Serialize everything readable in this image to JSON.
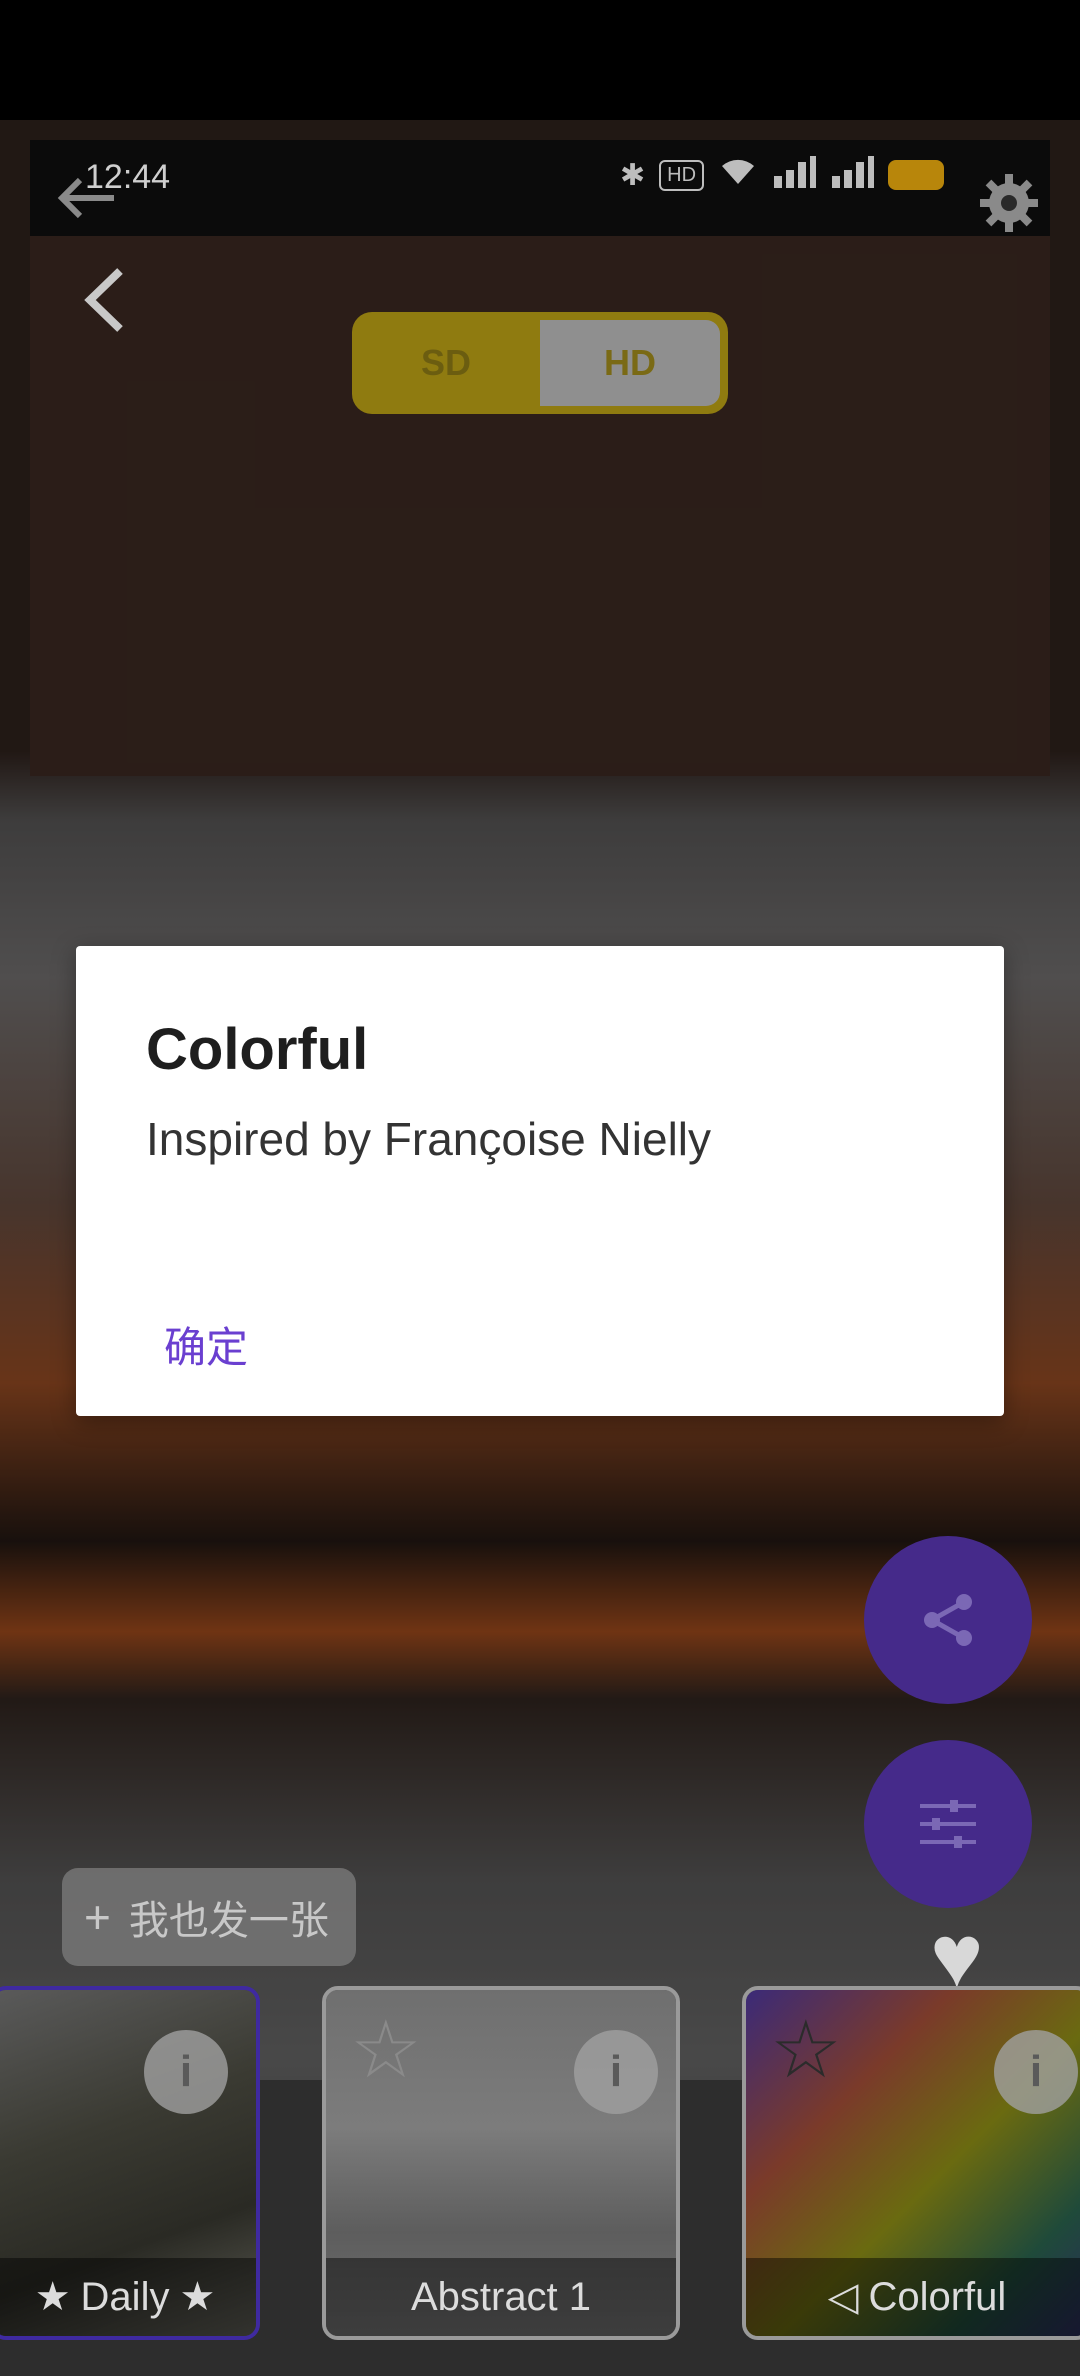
{
  "status_bar": {
    "time": "12:44",
    "icons": [
      "bluetooth-icon",
      "hd-icon",
      "wifi-icon",
      "signal-icon",
      "signal-icon",
      "battery-icon"
    ]
  },
  "toolbar": {
    "quality_toggle": {
      "sd_label": "SD",
      "hd_label": "HD",
      "selected": "SD"
    }
  },
  "dialog": {
    "title": "Colorful",
    "message": "Inspired by Françoise Nielly",
    "confirm_label": "确定"
  },
  "background": {
    "share_chip_label": "我也发一张"
  },
  "fabs": [
    "share-icon",
    "sliders-icon"
  ],
  "styles": [
    {
      "label": "Daily",
      "selected": true
    },
    {
      "label": "Abstract 1",
      "selected": false
    },
    {
      "label": "Colorful",
      "selected": false
    }
  ],
  "colors": {
    "accent": "#6a3fd0",
    "fab": "#452a8a",
    "toggle_yellow": "#8f7b10"
  }
}
